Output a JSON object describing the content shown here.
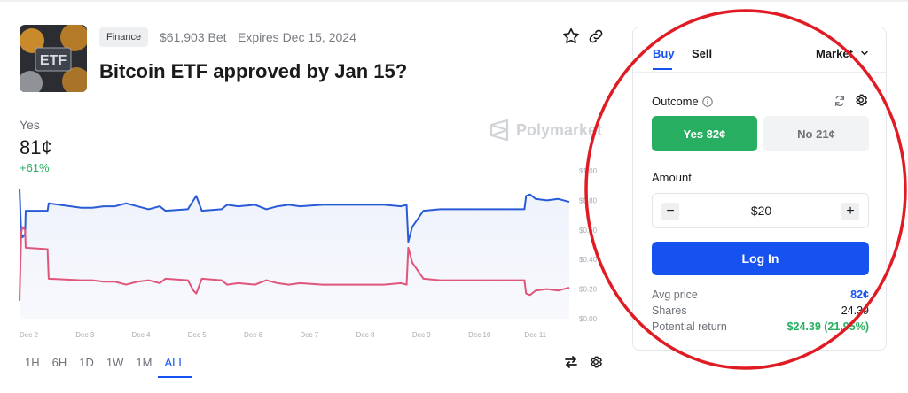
{
  "market": {
    "category": "Finance",
    "volume": "$61,903 Bet",
    "expires": "Expires Dec 15, 2024",
    "title": "Bitcoin ETF approved by Jan 15?",
    "thumbnail_text": "ETF"
  },
  "summary": {
    "outcome": "Yes",
    "price": "81¢",
    "change": "+61%"
  },
  "watermark": "Polymarket",
  "chart_data": {
    "type": "line",
    "x": [
      "Dec 2",
      "Dec 3",
      "Dec 4",
      "Dec 5",
      "Dec 6",
      "Dec 7",
      "Dec 8",
      "Dec 9",
      "Dec 10",
      "Dec 11"
    ],
    "yticks": [
      "$1.00",
      "$0.80",
      "$0.60",
      "$0.40",
      "$0.20",
      "$0.00"
    ],
    "ylim": [
      0,
      1
    ],
    "series": [
      {
        "color": "#2a5bd7",
        "points": [
          [
            0,
            0.88
          ],
          [
            0.03,
            0.58
          ],
          [
            0.05,
            0.55
          ],
          [
            0.1,
            0.57
          ],
          [
            0.11,
            0.73
          ],
          [
            0.5,
            0.73
          ],
          [
            0.52,
            0.78
          ],
          [
            1.1,
            0.75
          ],
          [
            1.3,
            0.75
          ],
          [
            1.5,
            0.76
          ],
          [
            1.7,
            0.76
          ],
          [
            1.9,
            0.78
          ],
          [
            2.1,
            0.76
          ],
          [
            2.3,
            0.74
          ],
          [
            2.5,
            0.76
          ],
          [
            2.6,
            0.73
          ],
          [
            3.0,
            0.74
          ],
          [
            3.1,
            0.8
          ],
          [
            3.15,
            0.83
          ],
          [
            3.25,
            0.73
          ],
          [
            3.6,
            0.74
          ],
          [
            3.7,
            0.77
          ],
          [
            3.9,
            0.76
          ],
          [
            4.2,
            0.77
          ],
          [
            4.4,
            0.74
          ],
          [
            4.6,
            0.76
          ],
          [
            4.8,
            0.77
          ],
          [
            5.0,
            0.76
          ],
          [
            5.4,
            0.77
          ],
          [
            6.0,
            0.77
          ],
          [
            6.5,
            0.77
          ],
          [
            6.8,
            0.76
          ],
          [
            6.9,
            0.77
          ],
          [
            6.93,
            0.52
          ],
          [
            7.0,
            0.62
          ],
          [
            7.2,
            0.73
          ],
          [
            7.5,
            0.74
          ],
          [
            8.0,
            0.74
          ],
          [
            8.5,
            0.74
          ],
          [
            8.8,
            0.74
          ],
          [
            9.0,
            0.74
          ],
          [
            9.03,
            0.83
          ],
          [
            9.1,
            0.84
          ],
          [
            9.2,
            0.81
          ],
          [
            9.4,
            0.8
          ],
          [
            9.6,
            0.81
          ],
          [
            9.8,
            0.79
          ]
        ]
      },
      {
        "color": "#e0557a",
        "points": [
          [
            0,
            0.12
          ],
          [
            0.03,
            0.58
          ],
          [
            0.05,
            0.62
          ],
          [
            0.1,
            0.6
          ],
          [
            0.11,
            0.48
          ],
          [
            0.5,
            0.47
          ],
          [
            0.52,
            0.27
          ],
          [
            1.1,
            0.26
          ],
          [
            1.3,
            0.26
          ],
          [
            1.5,
            0.25
          ],
          [
            1.7,
            0.25
          ],
          [
            1.9,
            0.23
          ],
          [
            2.1,
            0.25
          ],
          [
            2.3,
            0.26
          ],
          [
            2.5,
            0.24
          ],
          [
            2.6,
            0.27
          ],
          [
            3.0,
            0.26
          ],
          [
            3.1,
            0.19
          ],
          [
            3.15,
            0.17
          ],
          [
            3.25,
            0.27
          ],
          [
            3.6,
            0.26
          ],
          [
            3.7,
            0.23
          ],
          [
            3.9,
            0.24
          ],
          [
            4.2,
            0.23
          ],
          [
            4.4,
            0.26
          ],
          [
            4.6,
            0.24
          ],
          [
            4.8,
            0.23
          ],
          [
            5.0,
            0.24
          ],
          [
            5.4,
            0.23
          ],
          [
            6.0,
            0.23
          ],
          [
            6.5,
            0.23
          ],
          [
            6.8,
            0.24
          ],
          [
            6.9,
            0.23
          ],
          [
            6.93,
            0.48
          ],
          [
            7.0,
            0.38
          ],
          [
            7.2,
            0.27
          ],
          [
            7.5,
            0.26
          ],
          [
            8.0,
            0.26
          ],
          [
            8.5,
            0.26
          ],
          [
            8.8,
            0.26
          ],
          [
            9.0,
            0.26
          ],
          [
            9.03,
            0.17
          ],
          [
            9.1,
            0.16
          ],
          [
            9.2,
            0.19
          ],
          [
            9.4,
            0.2
          ],
          [
            9.6,
            0.19
          ],
          [
            9.8,
            0.21
          ]
        ]
      }
    ],
    "grid": false
  },
  "ranges": [
    "1H",
    "6H",
    "1D",
    "1W",
    "1M",
    "ALL"
  ],
  "active_range": "ALL",
  "trade": {
    "tab_buy": "Buy",
    "tab_sell": "Sell",
    "order_type": "Market",
    "outcome_label": "Outcome",
    "yes_button": "Yes 82¢",
    "no_button": "No 21¢",
    "amount_label": "Amount",
    "amount_value": "$20",
    "minus": "−",
    "plus": "+",
    "login_button": "Log In",
    "avg_price_label": "Avg price",
    "avg_price_value": "82¢",
    "shares_label": "Shares",
    "shares_value": "24.39",
    "return_label": "Potential return",
    "return_value": "$24.39 (21.95%)"
  },
  "colors": {
    "accent": "#1652f0",
    "yes": "#27ae60",
    "annotation": "#e01b24"
  }
}
